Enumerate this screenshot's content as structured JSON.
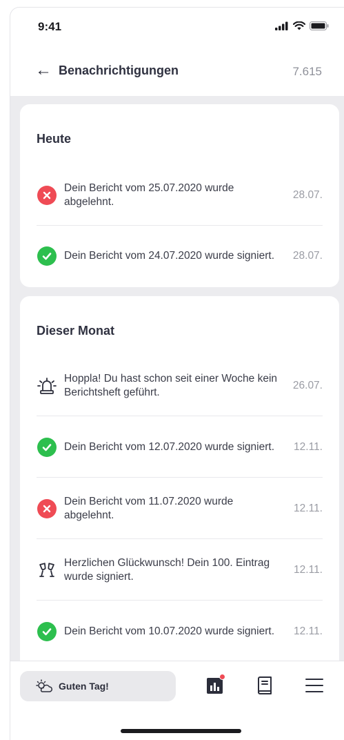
{
  "status": {
    "time": "9:41"
  },
  "header": {
    "title": "Benachrichtigungen",
    "count": "7.615"
  },
  "sections": [
    {
      "title": "Heute",
      "items": [
        {
          "icon": "rejected-icon",
          "text": "Dein Bericht vom 25.07.2020 wurde abgelehnt.",
          "date": "28.07."
        },
        {
          "icon": "approved-icon",
          "text": "Dein Bericht vom 24.07.2020 wurde signiert.",
          "date": "28.07."
        }
      ]
    },
    {
      "title": "Dieser Monat",
      "items": [
        {
          "icon": "alarm-siren-icon",
          "text": "Hoppla! Du hast schon seit einer Woche kein Berichtsheft geführt.",
          "date": "26.07."
        },
        {
          "icon": "approved-icon",
          "text": "Dein Bericht vom 12.07.2020 wurde signiert.",
          "date": "12.11."
        },
        {
          "icon": "rejected-icon",
          "text": "Dein Bericht vom 11.07.2020 wurde abgelehnt.",
          "date": "12.11."
        },
        {
          "icon": "celebration-glasses-icon",
          "text": "Herzlichen Glückwunsch! Dein 100. Eintrag wurde signiert.",
          "date": "12.11."
        },
        {
          "icon": "approved-icon",
          "text": "Dein Bericht vom 10.07.2020 wurde signiert.",
          "date": "12.11."
        }
      ]
    }
  ],
  "bottom_nav": {
    "greeting": "Guten Tag!",
    "items": [
      "stats-icon",
      "book-icon",
      "menu-icon"
    ]
  },
  "colors": {
    "rejected": "#ef4b55",
    "approved": "#2dbf4e",
    "background": "#ececef"
  }
}
